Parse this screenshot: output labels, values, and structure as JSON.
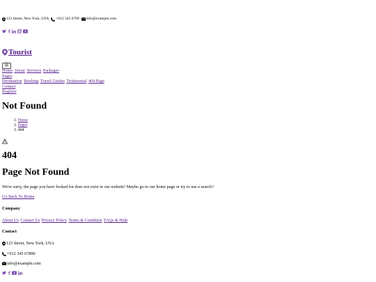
{
  "topbar": {
    "address": "123 Street, New York, USA",
    "phone": "+012 345 6789",
    "email": "info@example.com"
  },
  "brand": {
    "name": "Tourist"
  },
  "navbar": {
    "toggler_label": "☰",
    "items": [
      "Home",
      "About",
      "Services",
      "Packages",
      "Pages"
    ],
    "pages_dropdown": [
      "Destination",
      "Booking",
      "Travel Guides",
      "Testimonial",
      "404 Page"
    ],
    "contact": "Contact",
    "register": "Register"
  },
  "header": {
    "title": "Not Found",
    "breadcrumbs": [
      "Home",
      "Pages",
      "404"
    ],
    "breadcrumb_numbers": [
      "1.",
      "2.",
      "3."
    ]
  },
  "error": {
    "code": "404",
    "title": "Page Not Found",
    "message": "We're sorry, the page you have looked for does not exist in our website! Maybe go to our home page or try to use a search?",
    "button": "Go Back To Home"
  },
  "footer": {
    "company_heading": "Company",
    "company_links": [
      "About Us",
      "Contact Us",
      "Privacy Policy",
      "Terms & Condition",
      "FAQs & Help"
    ],
    "contact_heading": "Contact",
    "address": "123 Street, New York, USA",
    "phone": "+012 345 67890",
    "email": "info@example.com"
  },
  "icons": {
    "topbar": [
      "map-marker-icon",
      "phone-icon",
      "envelope-icon"
    ],
    "social_top": [
      "twitter-icon",
      "facebook-icon",
      "linkedin-icon",
      "instagram-icon",
      "youtube-icon"
    ],
    "social_footer": [
      "twitter-icon",
      "facebook-icon",
      "youtube-icon",
      "linkedin-icon"
    ],
    "warning": "warning-icon"
  },
  "colors": {
    "link": "#551a8b",
    "social": "#7a4fb0"
  }
}
